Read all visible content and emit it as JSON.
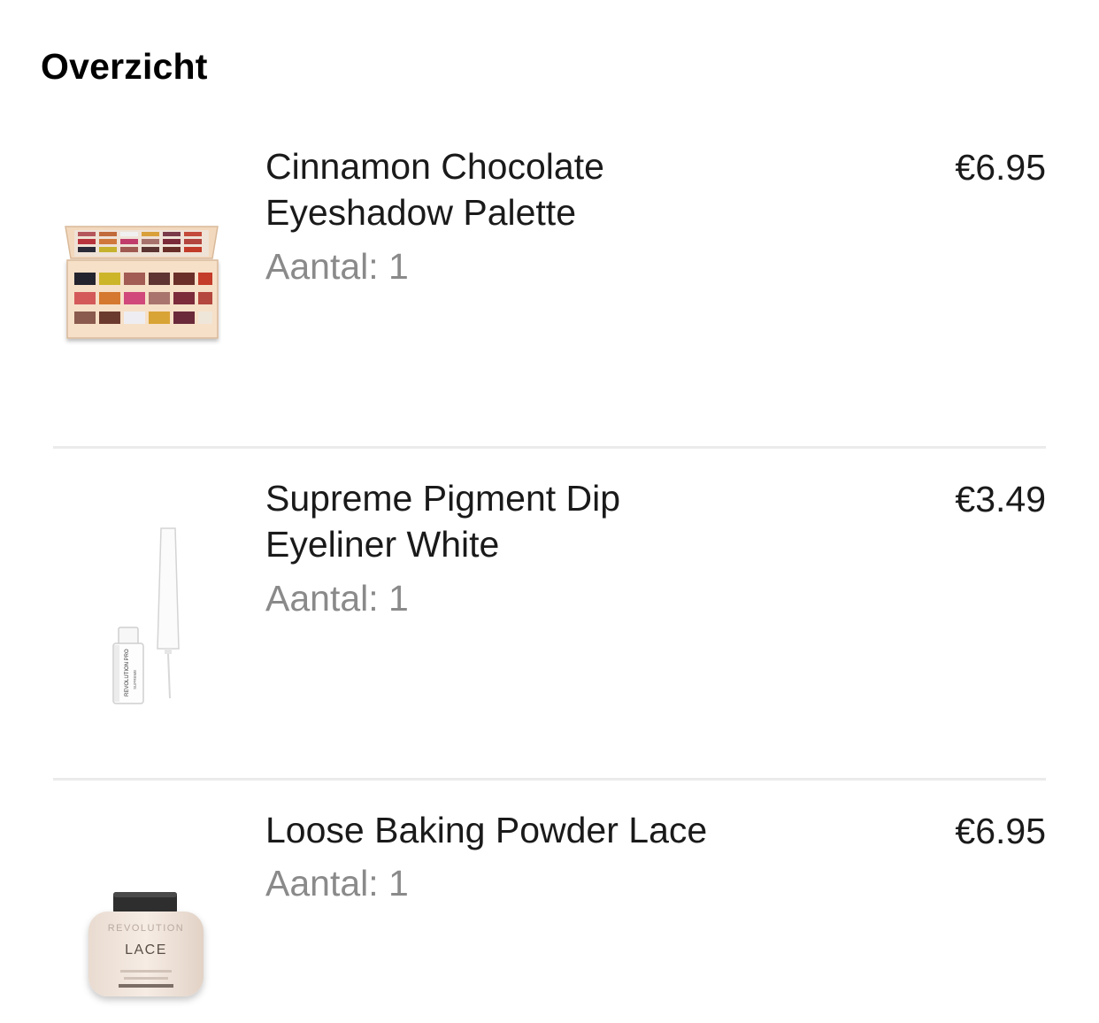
{
  "header": {
    "title": "Overzicht"
  },
  "items": [
    {
      "name_line1": "Cinnamon Chocolate",
      "name_line2": "Eyeshadow Palette",
      "quantity": "Aantal: 1",
      "price": "€6.95",
      "image": "eyeshadow-palette"
    },
    {
      "name_line1": "Supreme Pigment Dip",
      "name_line2": "Eyeliner White",
      "quantity": "Aantal: 1",
      "price": "€3.49",
      "image": "eyeliner-bottle"
    },
    {
      "name_line1": "Loose Baking Powder Lace",
      "name_line2": "",
      "quantity": "Aantal: 1",
      "price": "€6.95",
      "image": "powder-jar"
    }
  ],
  "product_labels": {
    "liner_brand": "REVOLUTION PRO",
    "liner_small": "SUPREME",
    "jar_brand": "REVOLUTION",
    "jar_shade": "LACE"
  }
}
